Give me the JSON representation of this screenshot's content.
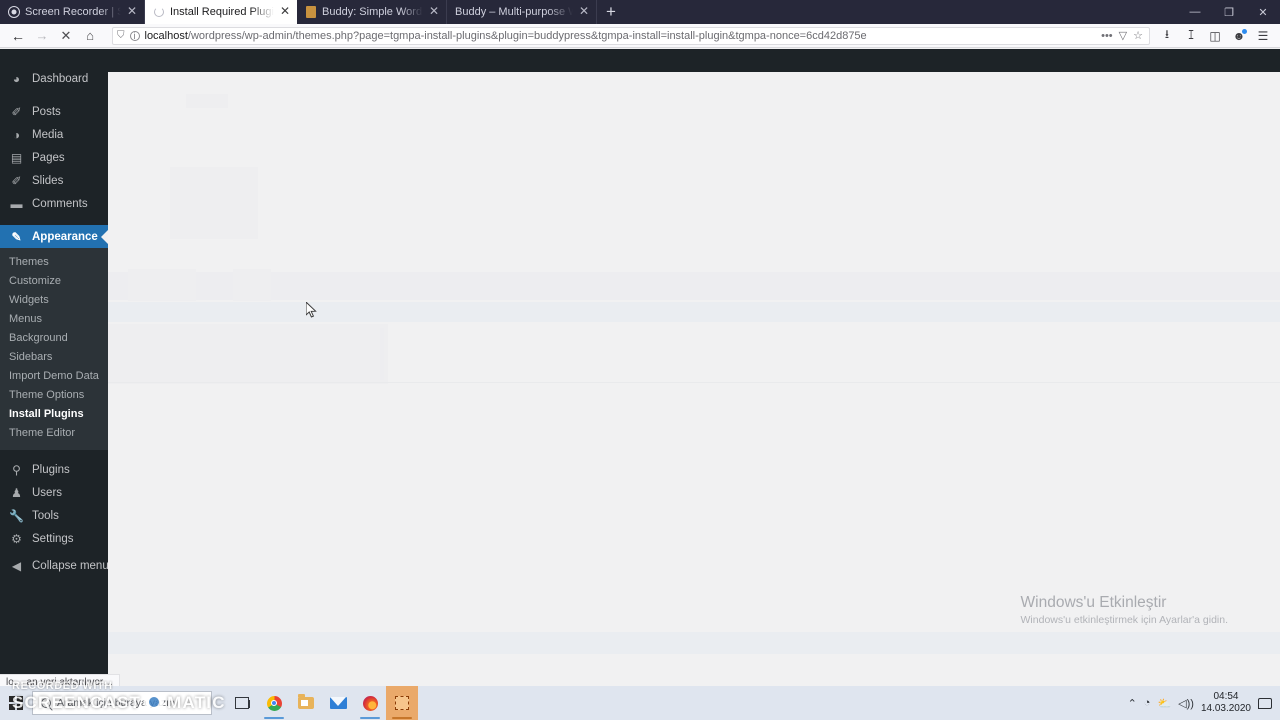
{
  "browser": {
    "tabs": [
      {
        "title": "Screen Recorder | Screencast-O",
        "favicon": "record-icon",
        "active": false
      },
      {
        "title": "Install Required Plugins ‹ Word",
        "favicon": "loading-spinner-icon",
        "active": true
      },
      {
        "title": "Buddy: Simple WordPress & Bu",
        "favicon": "wordpress-book-icon",
        "active": false
      },
      {
        "title": "Buddy – Multi-purpose WordPress",
        "favicon": "none",
        "active": false
      }
    ],
    "new_tab_label": "+",
    "window_controls": {
      "minimize": "—",
      "maximize": "❐",
      "close": "✕"
    },
    "nav": {
      "back_icon": "←",
      "forward_icon": "→",
      "stop_icon": "✕",
      "home_icon": "⌂"
    },
    "url": {
      "host": "localhost",
      "path": "/wordpress/wp-admin/themes.php?page=tgmpa-install-plugins&plugin=buddypress&tgmpa-install=install-plugin&tgmpa-nonce=6cd42d875e",
      "shield_icon": "shield-icon",
      "info_icon": "i",
      "menu_icon": "•••",
      "reader_icon": "reader-view-icon",
      "bookmark_icon": "☆"
    },
    "toolbar_icons": [
      "download-icon",
      "library-icon",
      "sidebar-icon",
      "account-icon",
      "app-menu-icon"
    ]
  },
  "wp_admin": {
    "menu": [
      {
        "label": "Dashboard",
        "icon": "dashboard-icon",
        "current": false
      },
      {
        "label": "Posts",
        "icon": "pin-icon",
        "current": false
      },
      {
        "label": "Media",
        "icon": "media-icon",
        "current": false
      },
      {
        "label": "Pages",
        "icon": "pages-icon",
        "current": false
      },
      {
        "label": "Slides",
        "icon": "pin-icon",
        "current": false
      },
      {
        "label": "Comments",
        "icon": "comment-icon",
        "current": false
      },
      {
        "label": "Appearance",
        "icon": "brush-icon",
        "current": true
      }
    ],
    "submenu": [
      {
        "label": "Themes",
        "current": false
      },
      {
        "label": "Customize",
        "current": false
      },
      {
        "label": "Widgets",
        "current": false
      },
      {
        "label": "Menus",
        "current": false
      },
      {
        "label": "Background",
        "current": false
      },
      {
        "label": "Sidebars",
        "current": false
      },
      {
        "label": "Import Demo Data",
        "current": false
      },
      {
        "label": "Theme Options",
        "current": false
      },
      {
        "label": "Install Plugins",
        "current": true
      },
      {
        "label": "Theme Editor",
        "current": false
      }
    ],
    "menu_bottom": [
      {
        "label": "Plugins",
        "icon": "plug-icon",
        "current": false
      },
      {
        "label": "Users",
        "icon": "user-icon",
        "current": false
      },
      {
        "label": "Tools",
        "icon": "wrench-icon",
        "current": false
      },
      {
        "label": "Settings",
        "icon": "settings-icon",
        "current": false
      },
      {
        "label": "Collapse menu",
        "icon": "collapse-icon",
        "current": false
      }
    ]
  },
  "status_bar": {
    "text": "lo… an veri aktarılıyor…"
  },
  "watermarks": {
    "screencast": {
      "line1": "RECORDED WITH",
      "line2_left": "SCREENCAST",
      "line2_right": "MATIC"
    },
    "windows_activation": {
      "title": "Windows'u Etkinleştir",
      "subtitle": "Windows'u etkinleştirmek için Ayarlar'a gidin."
    }
  },
  "taskbar": {
    "start_icon": "windows-logo-icon",
    "search_placeholder": "Aramak için buraya yazın",
    "buttons": [
      {
        "name": "task-view-button",
        "icon": "task-view-icon",
        "running": false,
        "active": false
      },
      {
        "name": "chrome-button",
        "icon": "chrome-icon",
        "running": true,
        "active": false
      },
      {
        "name": "file-explorer-button",
        "icon": "folder-icon",
        "running": false,
        "active": false
      },
      {
        "name": "mail-button",
        "icon": "mail-icon",
        "running": false,
        "active": false
      },
      {
        "name": "firefox-button",
        "icon": "firefox-icon",
        "running": true,
        "active": false
      },
      {
        "name": "screencast-o-matic-button",
        "icon": "screencast-icon",
        "running": true,
        "active": true
      }
    ],
    "tray": {
      "chevron": "⌃",
      "icons": [
        "network-icon",
        "onedrive-icon",
        "volume-icon"
      ],
      "time": "04:54",
      "date": "14.03.2020",
      "notification_icon": "notification-icon"
    }
  },
  "colors": {
    "wp_sidebar": "#1d2327",
    "wp_submenu": "#2c3338",
    "wp_current": "#2271b1",
    "page_bg": "#f1f1f2",
    "browser_chrome": "#27283a",
    "taskbar": "#dfe5ef"
  }
}
